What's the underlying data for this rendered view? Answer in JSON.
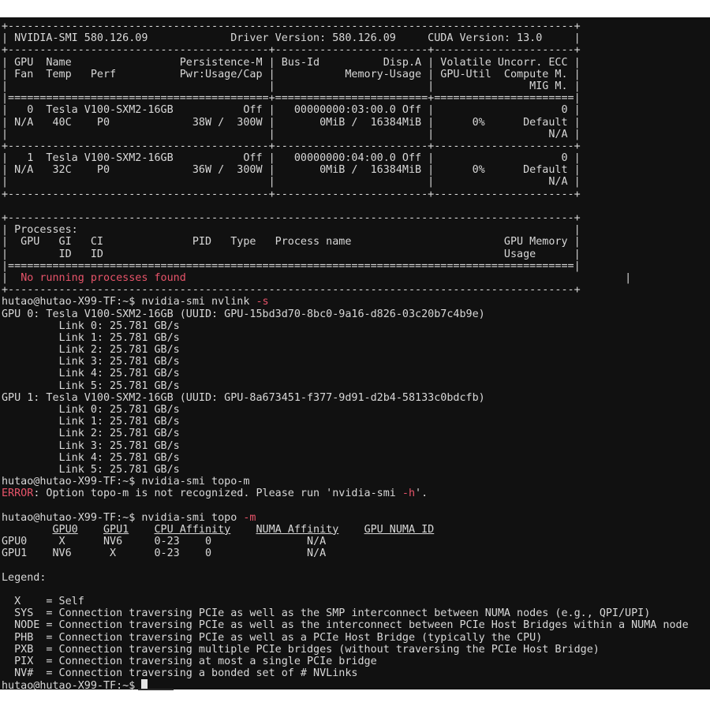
{
  "header": {
    "sep": "+-----------------------------------------------------------------------------------------+",
    "line": "| NVIDIA-SMI 580.126.09             Driver Version: 580.126.09     CUDA Version: 13.0     |"
  },
  "gpu_table": {
    "sep_top": "+-----------------------------------------+------------------------+----------------------+",
    "header1": "| GPU  Name                 Persistence-M | Bus-Id          Disp.A | Volatile Uncorr. ECC |",
    "header2": "| Fan  Temp   Perf          Pwr:Usage/Cap |           Memory-Usage | GPU-Util  Compute M. |",
    "header3": "|                                         |                        |               MIG M. |",
    "sep_double": "|=========================================+========================+======================|",
    "row_sep": "+-----------------------------------------+------------------------+----------------------+",
    "gpus": [
      {
        "l1": "|   0  Tesla V100-SXM2-16GB           Off |   00000000:03:00.0 Off |                    0 |",
        "l2": "| N/A   40C    P0             38W /  300W |       0MiB /  16384MiB |      0%      Default |",
        "l3": "|                                         |                        |                  N/A |"
      },
      {
        "l1": "|   1  Tesla V100-SXM2-16GB           Off |   00000000:04:00.0 Off |                    0 |",
        "l2": "| N/A   32C    P0             36W /  300W |       0MiB /  16384MiB |      0%      Default |",
        "l3": "|                                         |                        |                  N/A |"
      }
    ]
  },
  "processes": {
    "sep": "+-----------------------------------------------------------------------------------------+",
    "title": "| Processes:                                                                              |",
    "header1": "|  GPU   GI   CI              PID   Type   Process name                        GPU Memory |",
    "header2": "|        ID   ID                                                               Usage      |",
    "sep_double": "|=========================================================================================|",
    "row_left": "|  ",
    "no_procs": "No running processes found",
    "row_right": "                                                                     |"
  },
  "prompt": "hutao@hutao-X99-TF:~$ ",
  "nvlink": {
    "cmd_main": "nvidia-smi nvlink ",
    "cmd_flag": "-s",
    "gpus": [
      {
        "title": "GPU 0: Tesla V100-SXM2-16GB (UUID: GPU-15bd3d70-8bc0-9a16-d826-03c20b7c4b9e)",
        "links": [
          "         Link 0: 25.781 GB/s",
          "         Link 1: 25.781 GB/s",
          "         Link 2: 25.781 GB/s",
          "         Link 3: 25.781 GB/s",
          "         Link 4: 25.781 GB/s",
          "         Link 5: 25.781 GB/s"
        ]
      },
      {
        "title": "GPU 1: Tesla V100-SXM2-16GB (UUID: GPU-8a673451-f377-9d91-d2b4-58133c0bdcfb)",
        "links": [
          "         Link 0: 25.781 GB/s",
          "         Link 1: 25.781 GB/s",
          "         Link 2: 25.781 GB/s",
          "         Link 3: 25.781 GB/s",
          "         Link 4: 25.781 GB/s",
          "         Link 5: 25.781 GB/s"
        ]
      }
    ]
  },
  "topo_error": {
    "cmd": "nvidia-smi topo-m",
    "label": "ERROR",
    "msg_a": ": Option topo-m is not recognized. Please run 'nvidia-smi ",
    "msg_flag": "-h",
    "msg_b": "'."
  },
  "topo": {
    "cmd_main": "nvidia-smi topo ",
    "cmd_flag": "-m",
    "indent": "        ",
    "col_gpu0": "GPU0",
    "col_gpu1": "GPU1",
    "col_cpu": "CPU Affinity",
    "col_numa": "NUMA Affinity",
    "col_gpunuma": "GPU NUMA ID",
    "rows": [
      "GPU0     X      NV6     0-23    0               N/A",
      "GPU1    NV6      X      0-23    0               N/A"
    ]
  },
  "legend": {
    "title": "Legend:",
    "items": [
      "  X    = Self",
      "  SYS  = Connection traversing PCIe as well as the SMP interconnect between NUMA nodes (e.g., QPI/UPI)",
      "  NODE = Connection traversing PCIe as well as the interconnect between PCIe Host Bridges within a NUMA node",
      "  PHB  = Connection traversing PCIe as well as a PCIe Host Bridge (typically the CPU)",
      "  PXB  = Connection traversing multiple PCIe bridges (without traversing the PCIe Host Bridge)",
      "  PIX  = Connection traversing at most a single PCIe bridge",
      "  NV#  = Connection traversing a bonded set of # NVLinks"
    ]
  },
  "colors": {
    "background": "#111111",
    "text": "#d8d8d8",
    "error": "#e8546a"
  },
  "icons": {
    "cursor": "block-cursor"
  }
}
